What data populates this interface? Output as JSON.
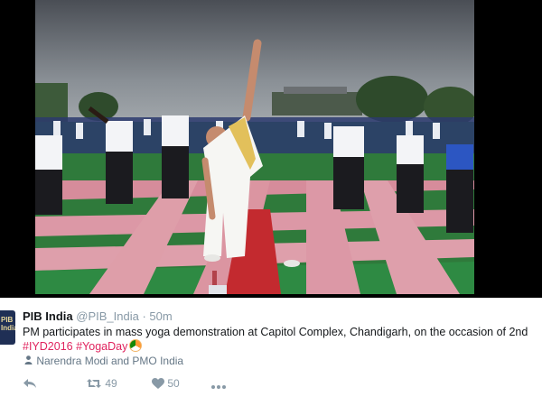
{
  "media": {
    "alt": "PM participates in mass yoga demonstration"
  },
  "tweet": {
    "account_name": "PIB India",
    "handle": "@PIB_India",
    "separator": "·",
    "time": "50m",
    "avatar_text": "PIB\nIndia",
    "text_main": "PM participates in mass yoga demonstration at Capitol Complex, Chandigarh, on the occasion of 2nd",
    "hashtags": [
      "#IYD2016",
      "#YogaDay"
    ],
    "tagged_people": "Narendra Modi and PMO India",
    "actions": {
      "reply_icon": "reply-icon",
      "retweet_icon": "retweet-icon",
      "retweet_count": "49",
      "like_icon": "heart-icon",
      "like_count": "50",
      "more_icon": "more-icon"
    }
  },
  "colors": {
    "hashtag": "#e0245e",
    "meta": "#8899a6",
    "text": "#14171a"
  }
}
